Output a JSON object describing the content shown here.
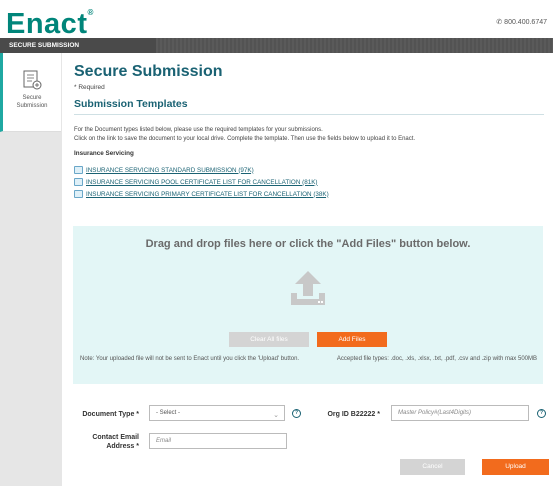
{
  "header": {
    "logo": "Enact",
    "logo_mark": "®",
    "phone": "800.400.6747"
  },
  "topbar": {
    "title": "SECURE SUBMISSION"
  },
  "sidebar": {
    "item_label_1": "Secure",
    "item_label_2": "Submission"
  },
  "main": {
    "title": "Secure Submission",
    "required_note": "* Required",
    "templates_title": "Submission Templates",
    "instructions_1": "For the Document types listed below, please use the required templates for your submissions.",
    "instructions_2": "Click on the link to save the document to your local drive. Complete the template. Then use the fields below to upload it to Enact.",
    "section_title": "Insurance Servicing",
    "links": [
      "INSURANCE SERVICING STANDARD SUBMISSION (97K)",
      "INSURANCE SERVICING POOL CERTIFICATE LIST FOR CANCELLATION (81K)",
      "INSURANCE SERVICING PRIMARY CERTIFICATE LIST FOR CANCELLATION (38K)"
    ]
  },
  "dropzone": {
    "title": "Drag and drop files here or click the \"Add Files\" button below.",
    "clear_label": "Clear All files",
    "add_label": "Add Files",
    "note": "Note: Your uploaded file will not be sent to Enact until you click the 'Upload' button.",
    "accepted": "Accepted file types: .doc, .xls, .xlsx, .txt, .pdf, .csv and .zip with max 500MB"
  },
  "form": {
    "doc_type_label": "Document Type *",
    "doc_type_value": "- Select -",
    "org_label": "Org ID B22222 *",
    "org_placeholder": "Master Policy#(Last4Digits)",
    "email_label_1": "Contact Email",
    "email_label_2": "Address *",
    "email_placeholder": "Email",
    "cancel_label": "Cancel",
    "upload_label": "Upload"
  },
  "colors": {
    "brand": "#00857a",
    "accent": "#f26b1d",
    "heading": "#1a6273",
    "dropzone": "#e3f6f6"
  }
}
